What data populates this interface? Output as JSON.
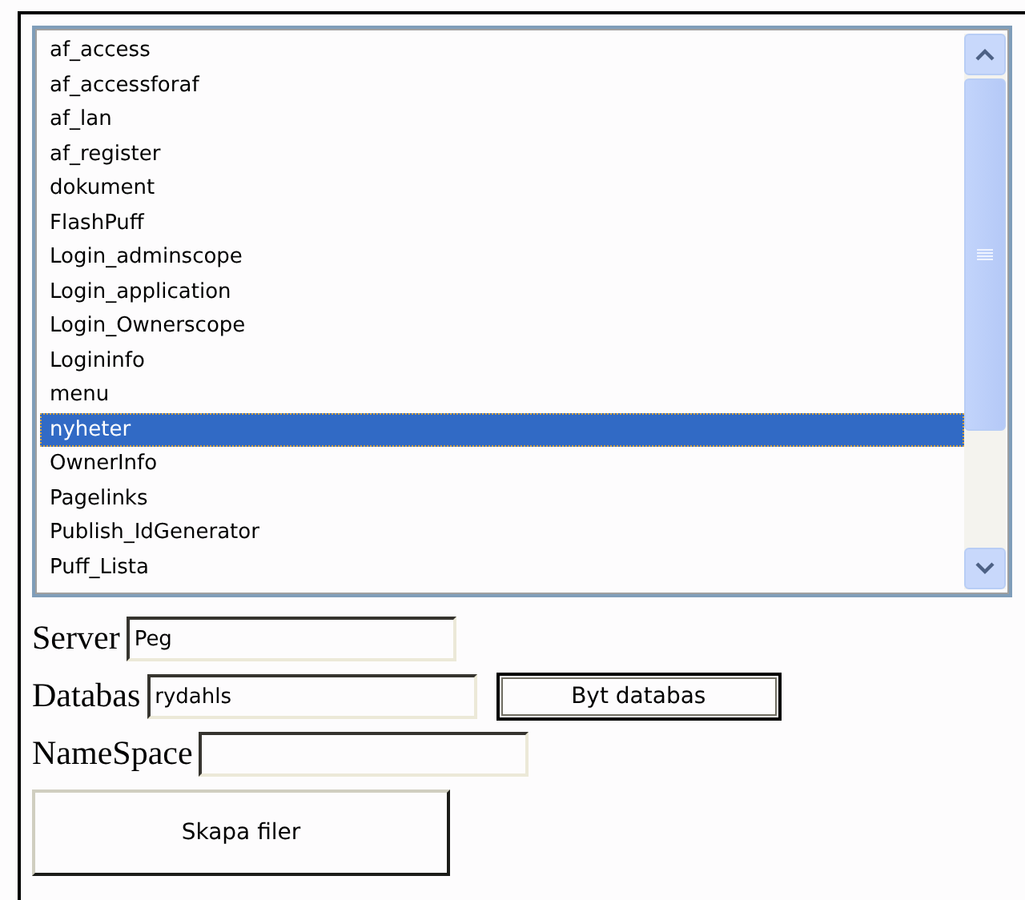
{
  "listbox": {
    "items": [
      {
        "label": "af_access",
        "selected": false
      },
      {
        "label": "af_accessforaf",
        "selected": false
      },
      {
        "label": "af_lan",
        "selected": false
      },
      {
        "label": "af_register",
        "selected": false
      },
      {
        "label": "dokument",
        "selected": false
      },
      {
        "label": "FlashPuff",
        "selected": false
      },
      {
        "label": "Login_adminscope",
        "selected": false
      },
      {
        "label": "Login_application",
        "selected": false
      },
      {
        "label": "Login_Ownerscope",
        "selected": false
      },
      {
        "label": "Logininfo",
        "selected": false
      },
      {
        "label": "menu",
        "selected": false
      },
      {
        "label": "nyheter",
        "selected": true
      },
      {
        "label": "OwnerInfo",
        "selected": false
      },
      {
        "label": "Pagelinks",
        "selected": false
      },
      {
        "label": "Publish_IdGenerator",
        "selected": false
      },
      {
        "label": "Puff_Lista",
        "selected": false
      }
    ]
  },
  "form": [
    {
      "label": "Server",
      "value": "Peg"
    },
    {
      "label": "Databas",
      "value": "rydahls",
      "button": "Byt databas"
    },
    {
      "label": "NameSpace"
    }
  ],
  "submit": "Skapa filer"
}
